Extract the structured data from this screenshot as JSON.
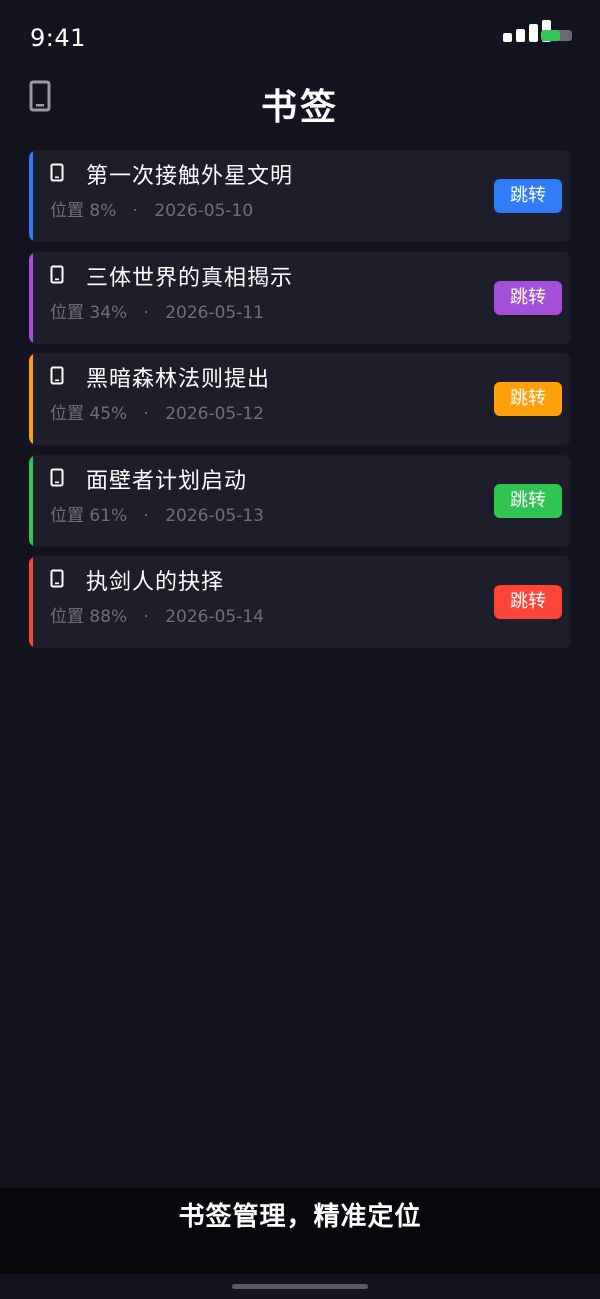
{
  "status_bar": {
    "time": "9:41",
    "battery_level": 0.62,
    "battery_color": "#34c759",
    "signal_bars": 4
  },
  "header": {
    "title": "书签",
    "left_icon": "phone-icon"
  },
  "bookmarks": [
    {
      "title": "第一次接触外星文明",
      "position": "位置 8%",
      "date": "2026-05-10",
      "accent": "#2f7cf6",
      "button_label": "跳转",
      "icon": "phone-icon"
    },
    {
      "title": "三体世界的真相揭示",
      "position": "位置 34%",
      "date": "2026-05-11",
      "accent": "#a450d9",
      "button_label": "跳转",
      "icon": "phone-icon"
    },
    {
      "title": "黑暗森林法则提出",
      "position": "位置 45%",
      "date": "2026-05-12",
      "accent": "#ff9f0a",
      "button_label": "跳转",
      "icon": "phone-icon"
    },
    {
      "title": "面壁者计划启动",
      "position": "位置 61%",
      "date": "2026-05-13",
      "accent": "#30c452",
      "button_label": "跳转",
      "icon": "phone-icon"
    },
    {
      "title": "执剑人的抉择",
      "position": "位置 88%",
      "date": "2026-05-14",
      "accent": "#ff453a",
      "button_label": "跳转",
      "icon": "phone-icon"
    }
  ],
  "meta_separator": "·",
  "caption": "书签管理，精准定位"
}
